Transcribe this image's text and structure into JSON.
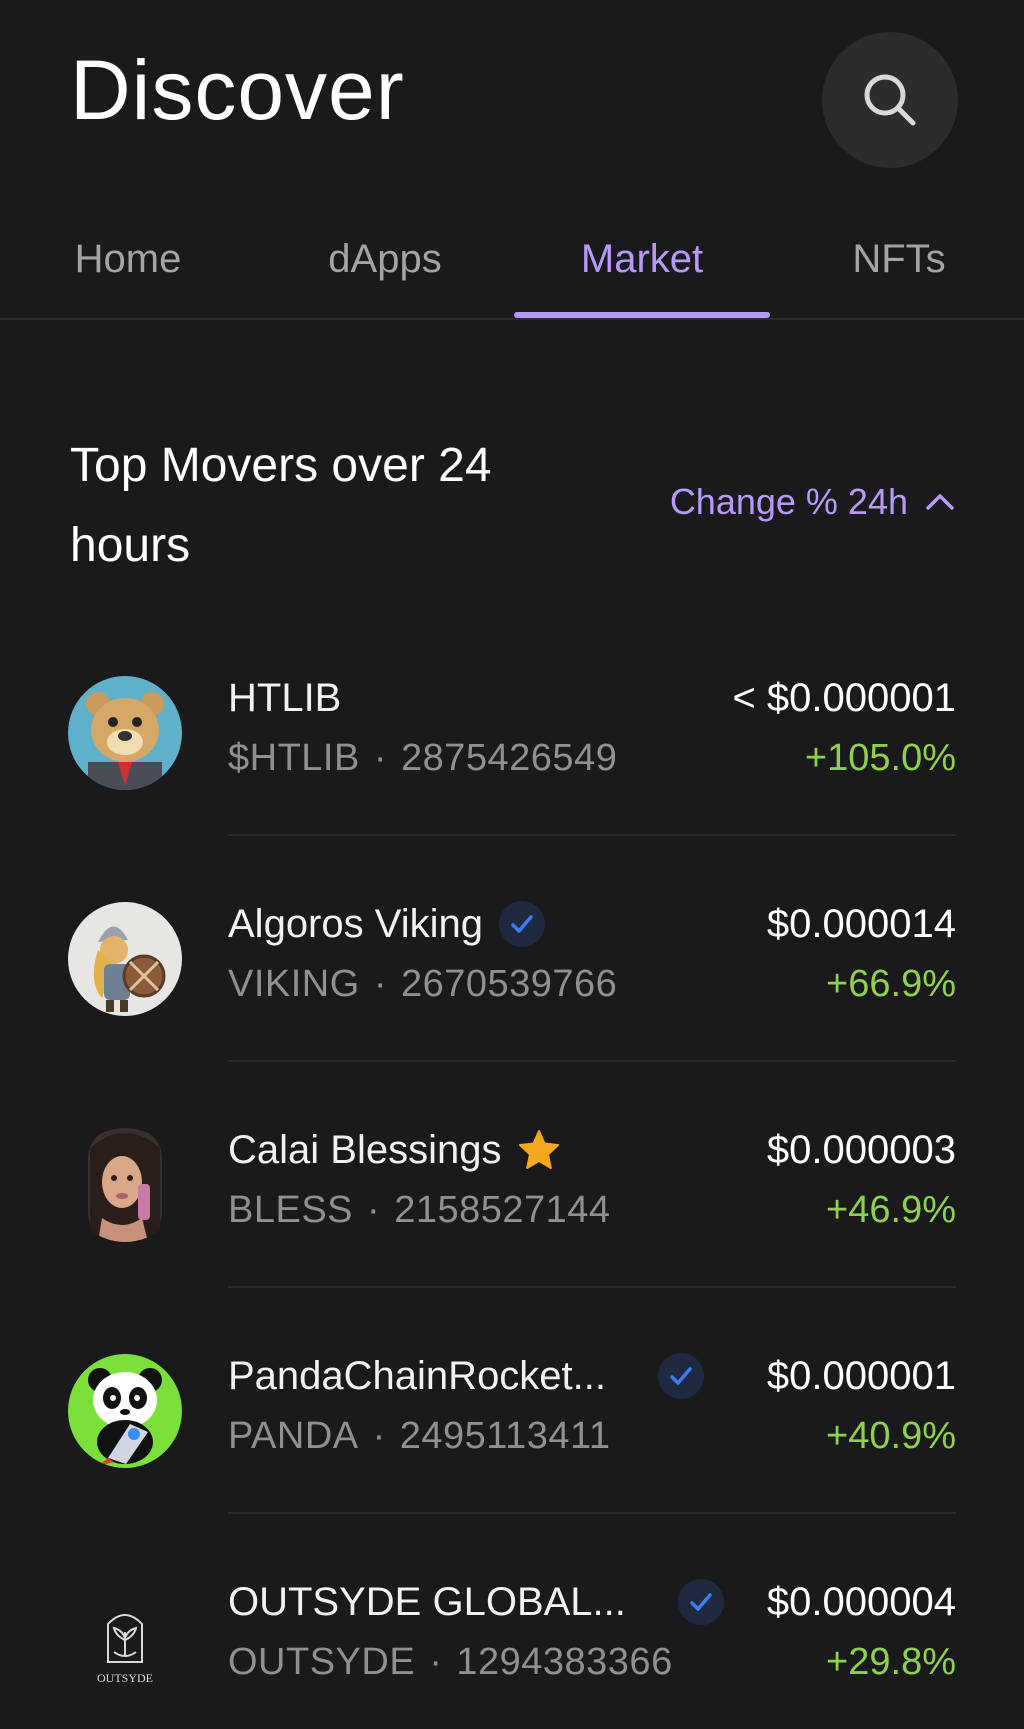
{
  "header": {
    "title": "Discover",
    "search_icon": "search-icon"
  },
  "tabs": [
    {
      "label": "Home",
      "active": false
    },
    {
      "label": "dApps",
      "active": false
    },
    {
      "label": "Market",
      "active": true
    },
    {
      "label": "NFTs",
      "active": false
    }
  ],
  "section": {
    "title": "Top Movers over 24 hours",
    "sort_label": "Change % 24h",
    "sort_icon": "chevron-up-icon"
  },
  "colors": {
    "accent": "#b79af7",
    "positive": "#8fd14f",
    "verified": "#3d7bf2",
    "star": "#f4a81d",
    "background": "#1a1a1c"
  },
  "tokens": [
    {
      "name": "HTLIB",
      "symbol": "$HTLIB",
      "id": "2875426549",
      "separator": "·",
      "price": "< $0.000001",
      "change": "+105.0%",
      "badge": "none"
    },
    {
      "name": "Algoros Viking",
      "symbol": "VIKING",
      "id": "2670539766",
      "separator": "·",
      "price": "$0.000014",
      "change": "+66.9%",
      "badge": "verified-icon"
    },
    {
      "name": "Calai Blessings",
      "symbol": "BLESS",
      "id": "2158527144",
      "separator": "·",
      "price": "$0.000003",
      "change": "+46.9%",
      "badge": "star-icon"
    },
    {
      "name": "PandaChainRocket...",
      "symbol": "PANDA",
      "id": "2495113411",
      "separator": "·",
      "price": "$0.000001",
      "change": "+40.9%",
      "badge": "verified-icon"
    },
    {
      "name": "OUTSYDE GLOBAL...",
      "symbol": "OUTSYDE",
      "id": "1294383366",
      "separator": "·",
      "price": "$0.000004",
      "change": "+29.8%",
      "badge": "verified-icon",
      "logo_text": "OUTSYDE"
    }
  ]
}
